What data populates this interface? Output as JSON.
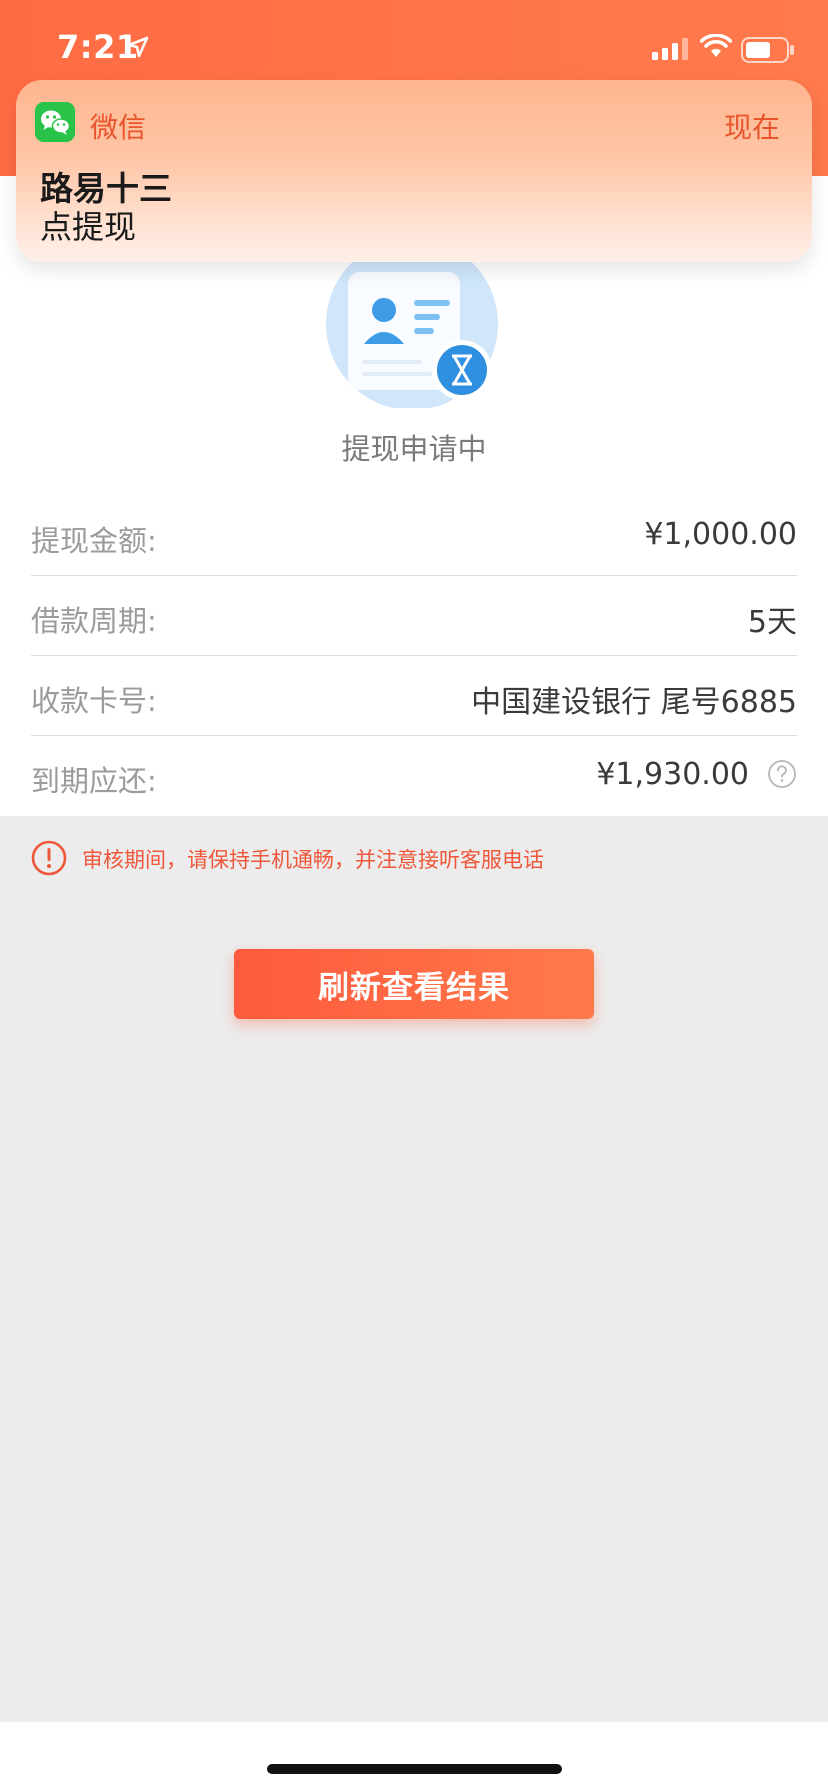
{
  "status_bar": {
    "time": "7:21",
    "location_icon": "location-arrow-icon",
    "signal_icon": "cellular-signal-icon",
    "wifi_icon": "wifi-icon",
    "battery_icon": "battery-icon"
  },
  "notification": {
    "app_icon": "wechat-icon",
    "app_name": "微信",
    "time": "现在",
    "title": "路易十三",
    "body": "点提现"
  },
  "status": {
    "illustration_icon": "id-card-hourglass-icon",
    "title": "提现申请中"
  },
  "details": [
    {
      "label": "提现金额:",
      "value": "¥1,000.00"
    },
    {
      "label": "借款周期:",
      "value": "5天"
    },
    {
      "label": "收款卡号:",
      "value": "中国建设银行 尾号6885"
    },
    {
      "label": "到期应还:",
      "value": "¥1,930.00",
      "help_icon": "question-circle-icon"
    }
  ],
  "notice": {
    "icon": "info-circle-icon",
    "text": "审核期间，请保持手机通畅，并注意接听客服电话"
  },
  "action": {
    "refresh_label": "刷新查看结果"
  },
  "colors": {
    "brand": "#ff6c44",
    "notice": "#f0573a",
    "wechat": "#29c34a"
  }
}
